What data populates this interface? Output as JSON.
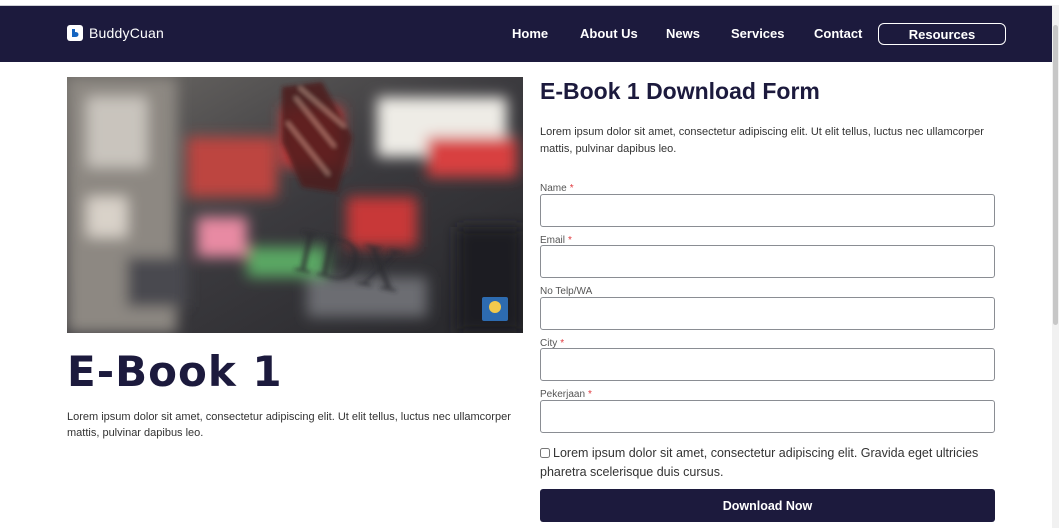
{
  "navbar": {
    "brand": "BuddyCuan",
    "links": [
      "Home",
      "About Us",
      "News",
      "Services",
      "Contact"
    ],
    "cta": "Resources"
  },
  "ebook": {
    "title": "E-Book 1",
    "description": "Lorem ipsum dolor sit amet, consectetur adipiscing elit. Ut elit tellus, luctus nec ullamcorper mattis, pulvinar dapibus leo.",
    "image_text": "IDX"
  },
  "form": {
    "title": "E-Book 1 Download Form",
    "description": "Lorem ipsum dolor sit amet, consectetur adipiscing elit. Ut elit tellus, luctus nec ullamcorper mattis, pulvinar dapibus leo.",
    "fields": [
      {
        "label": "Name",
        "required": "*",
        "value": ""
      },
      {
        "label": "Email",
        "required": "*",
        "value": ""
      },
      {
        "label": "No Telp/WA",
        "required": "",
        "value": ""
      },
      {
        "label": "City",
        "required": "*",
        "value": ""
      },
      {
        "label": "Pekerjaan",
        "required": "*",
        "value": ""
      }
    ],
    "consent": "Lorem ipsum dolor sit amet, consectetur adipiscing elit. Gravida eget ultricies pharetra scelerisque duis cursus.",
    "submit": "Download Now"
  },
  "colors": {
    "navy": "#1c1a3d",
    "required": "#e0393e"
  }
}
